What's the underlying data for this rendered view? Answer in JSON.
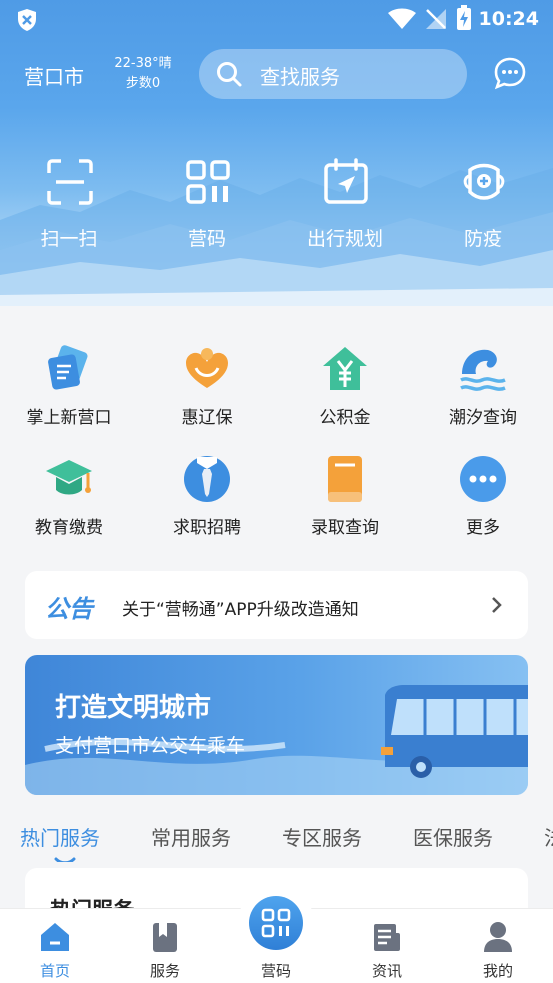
{
  "status_bar": {
    "time": "10:24"
  },
  "header": {
    "city": "营口市",
    "weather": "22-38°晴",
    "steps": "步数0",
    "search_placeholder": "查找服务"
  },
  "quick_actions": [
    {
      "label": "扫一扫",
      "icon": "scan-icon"
    },
    {
      "label": "营码",
      "icon": "qr-code-icon"
    },
    {
      "label": "出行规划",
      "icon": "calendar-navigation-icon"
    },
    {
      "label": "防疫",
      "icon": "mask-icon"
    }
  ],
  "services": [
    {
      "label": "掌上新营口",
      "icon": "news-card-icon"
    },
    {
      "label": "惠辽保",
      "icon": "heart-hands-icon"
    },
    {
      "label": "公积金",
      "icon": "house-yuan-icon"
    },
    {
      "label": "潮汐查询",
      "icon": "wave-icon"
    },
    {
      "label": "教育缴费",
      "icon": "graduation-cap-icon"
    },
    {
      "label": "求职招聘",
      "icon": "necktie-icon"
    },
    {
      "label": "录取查询",
      "icon": "book-icon"
    },
    {
      "label": "更多",
      "icon": "more-icon"
    }
  ],
  "notice": {
    "tag": "公告",
    "text": "关于“营畅通”APP升级改造通知"
  },
  "banner": {
    "title": "打造文明城市",
    "subtitle": "支付营口市公交车乘车"
  },
  "tabs": [
    {
      "label": "热门服务",
      "active": true
    },
    {
      "label": "常用服务",
      "active": false
    },
    {
      "label": "专区服务",
      "active": false
    },
    {
      "label": "医保服务",
      "active": false
    },
    {
      "label": "法",
      "active": false
    }
  ],
  "section_card": {
    "title": "热门服务"
  },
  "bottom_nav": [
    {
      "label": "首页",
      "icon": "home-icon",
      "active": true
    },
    {
      "label": "服务",
      "icon": "bookmark-icon",
      "active": false
    },
    {
      "label": "营码",
      "icon": "qr-code-icon",
      "active": false
    },
    {
      "label": "资讯",
      "icon": "newspaper-icon",
      "active": false
    },
    {
      "label": "我的",
      "icon": "user-icon",
      "active": false
    }
  ],
  "colors": {
    "accent": "#3d8ee0",
    "header_top": "#4f9be6",
    "page_bg": "#f4f5f7"
  }
}
